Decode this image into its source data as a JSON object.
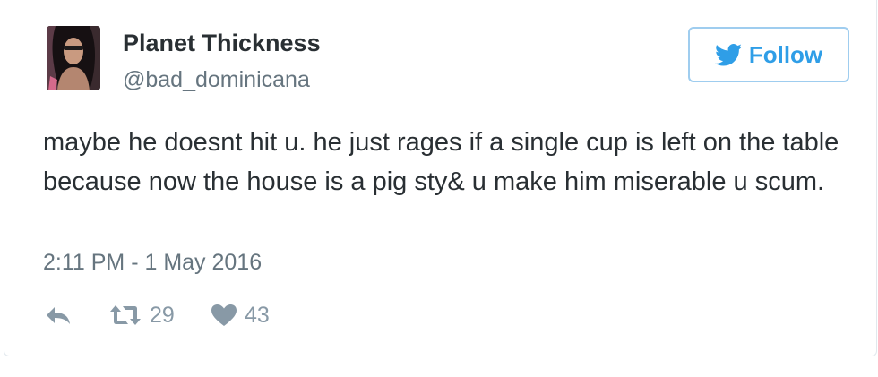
{
  "tweet": {
    "author_name": "Planet Thickness",
    "author_handle": "@bad_dominicana",
    "follow_label": "Follow",
    "text": "maybe he doesnt hit u. he just rages if a single cup is left on the table because now the house is a pig sty& u make him miserable u scum.",
    "timestamp": "2:11 PM - 1 May 2016",
    "retweet_count": "29",
    "like_count": "43"
  },
  "icons": {
    "follow": "bird-icon",
    "reply": "reply-icon",
    "retweet": "retweet-icon",
    "like": "heart-icon"
  },
  "colors": {
    "accent": "#2f9ee7",
    "follow_border": "#9fcdef",
    "text": "#292f33",
    "secondary_text": "#66757f",
    "action_icons": "#8899a6"
  }
}
